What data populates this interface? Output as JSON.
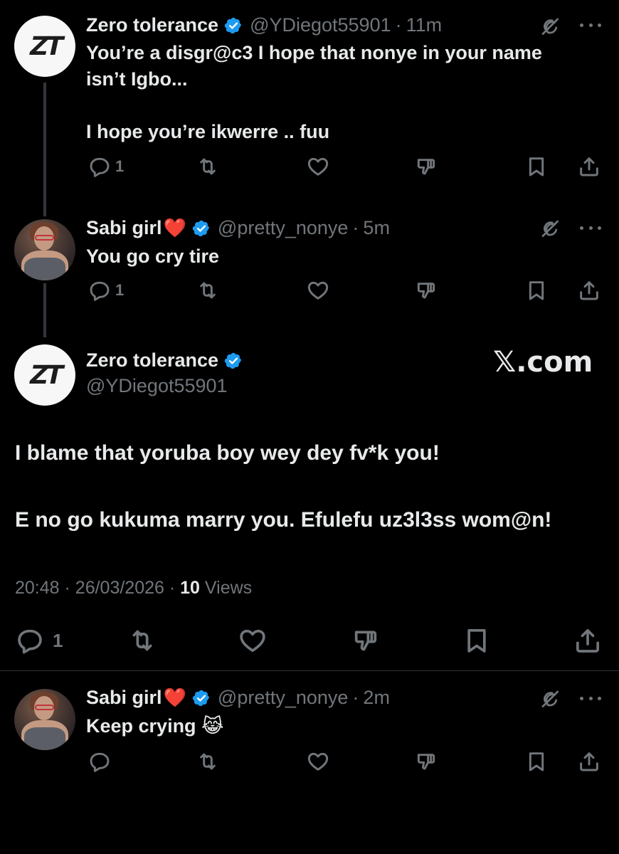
{
  "tweets": [
    {
      "name": "Zero tolerance",
      "handle": "@YDiegot55901",
      "time": "11m",
      "text": "You’re a disgr@c3 I hope that nonye in your name\nisn’t Igbo...\n\nI hope you’re ikwerre .. fuu",
      "reply_count": "1",
      "avatar_text": "ZT"
    },
    {
      "name": "Sabi girl",
      "heart": "❤️",
      "handle": "@pretty_nonye",
      "time": "5m",
      "text": "You go cry tire",
      "reply_count": "1"
    }
  ],
  "main": {
    "name": "Zero tolerance",
    "handle": "@YDiegot55901",
    "avatar_text": "ZT",
    "watermark": "𝕏.com",
    "text_line1": "I blame that yoruba boy wey dey fv*k you!",
    "text_line2": "E no go kukuma marry you. Efulefu uz3l3ss wom@n!",
    "time": "20:48",
    "date": "26/03/2026",
    "views_count": "10",
    "views_label": "Views",
    "reply_count": "1"
  },
  "reply": {
    "name": "Sabi girl",
    "heart": "❤️",
    "handle": "@pretty_nonye",
    "time": "2m",
    "text": "Keep crying 😹"
  },
  "separator": "·",
  "icons": {
    "reply": "reply-icon",
    "retweet": "retweet-icon",
    "like": "heart-icon",
    "dislike": "dislike-icon",
    "bookmark": "bookmark-icon",
    "share": "share-icon",
    "grok": "grok-icon",
    "more": "more-icon",
    "verified": "verified-badge-icon"
  },
  "colors": {
    "background": "#000000",
    "text": "#e7e9ea",
    "muted": "#71767b",
    "verified": "#1d9bf0",
    "heart": "#e0245e"
  }
}
